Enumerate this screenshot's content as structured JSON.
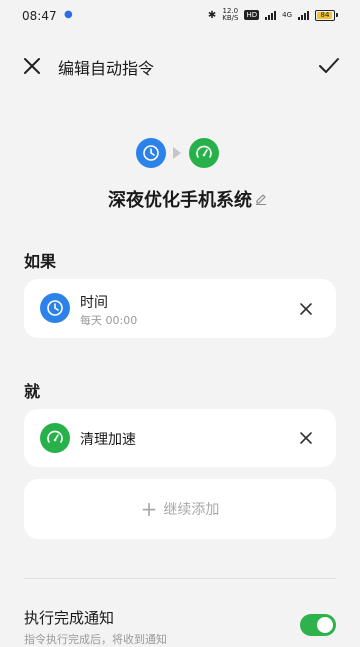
{
  "status_bar": {
    "time": "08:47",
    "net_speed_value": "12.0",
    "net_speed_unit": "KB/S",
    "hd_label": "HD",
    "network_type": "4G",
    "battery_level": "84"
  },
  "header": {
    "title": "编辑自动指令",
    "close_icon": "close-icon",
    "confirm_icon": "check-icon"
  },
  "command": {
    "name": "深夜优化手机系统",
    "edit_icon": "pencil-icon"
  },
  "if_section": {
    "label": "如果",
    "conditions": [
      {
        "title": "时间",
        "subtitle": "每天 00:00",
        "icon": "clock-icon",
        "color": "#2d82ea"
      }
    ]
  },
  "then_section": {
    "label": "就",
    "actions": [
      {
        "title": "清理加速",
        "icon": "gauge-icon",
        "color": "#27b14a"
      }
    ],
    "add_label": "继续添加"
  },
  "notification": {
    "title": "执行完成通知",
    "subtitle": "指令执行完成后，将收到通知",
    "enabled": true
  },
  "colors": {
    "accent_blue": "#2d82ea",
    "accent_green": "#27b14a",
    "toggle_on": "#2fb24b",
    "background": "#f3f3f3"
  }
}
